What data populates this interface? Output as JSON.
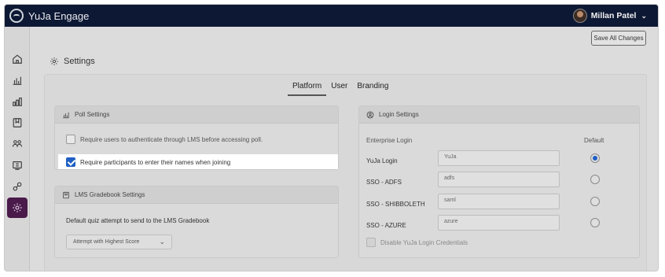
{
  "app": {
    "name": "YuJa Engage"
  },
  "user": {
    "name": "Millan Patel"
  },
  "header": {
    "save_all": "Save All Changes",
    "page_title": "Settings"
  },
  "sidebar": {
    "items": [
      {
        "icon": "home-icon"
      },
      {
        "icon": "analytics-icon"
      },
      {
        "icon": "bar-chart-icon"
      },
      {
        "icon": "bookmark-icon"
      },
      {
        "icon": "users-icon"
      },
      {
        "icon": "media-icon"
      },
      {
        "icon": "integrations-icon"
      },
      {
        "icon": "gear-icon",
        "active": true
      }
    ]
  },
  "tabs": [
    {
      "label": "Platform",
      "active": true
    },
    {
      "label": "User",
      "active": false
    },
    {
      "label": "Branding",
      "active": false
    }
  ],
  "poll_settings": {
    "title": "Poll Settings",
    "options": [
      {
        "label": "Require users to authenticate through LMS before accessing poll.",
        "checked": false
      },
      {
        "label": "Require participants to enter their names when joining",
        "checked": true
      }
    ]
  },
  "lms_gradebook": {
    "title": "LMS Gradebook Settings",
    "description": "Default quiz attempt to send to the LMS Gradebook",
    "selected": "Attempt with Highest Score"
  },
  "login_settings": {
    "title": "Login Settings",
    "enterprise_label": "Enterprise Login",
    "default_label": "Default",
    "rows": [
      {
        "label": "YuJa Login",
        "value": "YuJa",
        "default": true
      },
      {
        "label": "SSO - ADFS",
        "value": "adfs",
        "default": false
      },
      {
        "label": "SSO - SHIBBOLETH",
        "value": "saml",
        "default": false
      },
      {
        "label": "SSO - AZURE",
        "value": "azure",
        "default": false
      }
    ],
    "disable_label": "Disable YuJa Login Credentials"
  },
  "colors": {
    "topbar": "#0d1934",
    "active_sidebar": "#4a1a4b",
    "checkbox": "#1f5fc4"
  }
}
